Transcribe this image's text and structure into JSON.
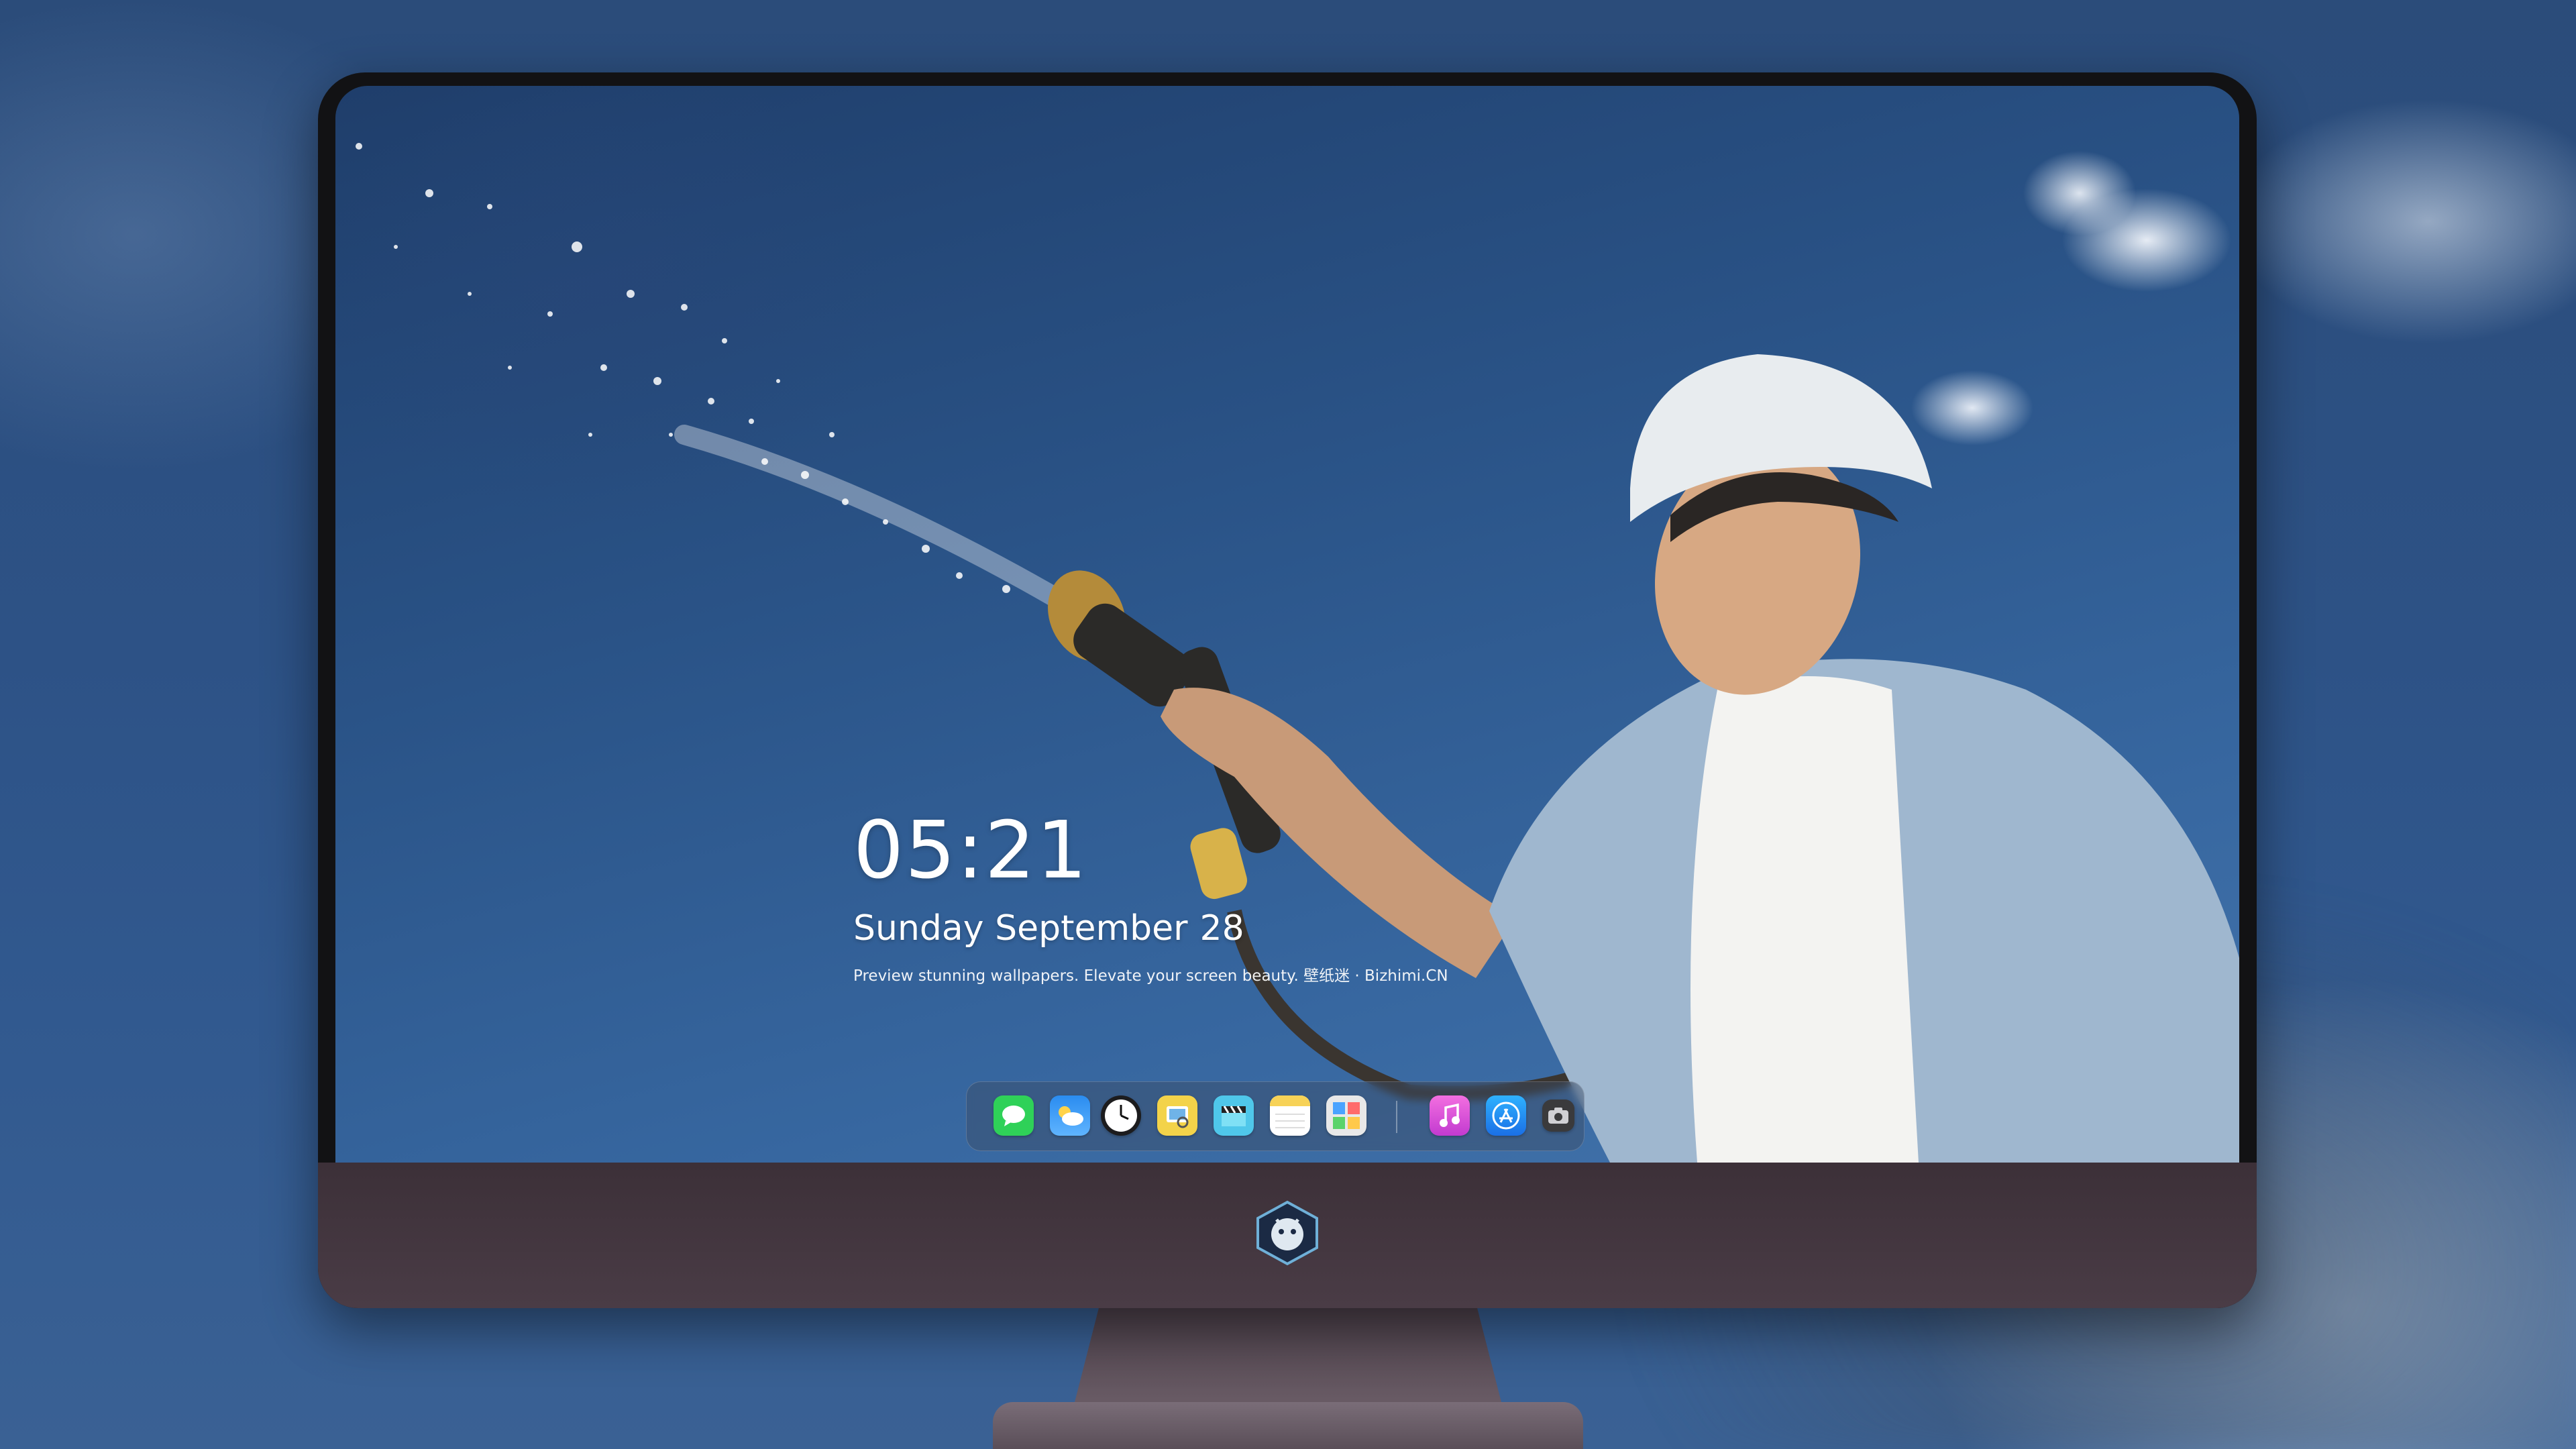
{
  "lockscreen": {
    "time": "05:21",
    "weekday_month": "Sunday September",
    "day": "28",
    "tagline": "Preview stunning wallpapers. Elevate your screen beauty. 壁纸迷 · Bizhimi.CN"
  },
  "dock": {
    "apps": [
      {
        "name": "messages-icon",
        "color": "#2fd158"
      },
      {
        "name": "weather-icon",
        "color": "#2a8cf0"
      },
      {
        "name": "clock-icon",
        "color": "#1c1c1e"
      },
      {
        "name": "preview-icon",
        "color": "#f3d34a"
      },
      {
        "name": "clips-icon",
        "color": "#4fc7ea"
      },
      {
        "name": "notes-icon",
        "color": "#f7d257"
      },
      {
        "name": "photo-booth-icon",
        "color": "#e8e8e8"
      },
      {
        "name": "music-icon",
        "color": "#e84fd6"
      },
      {
        "name": "app-store-icon",
        "color": "#1e90ff"
      },
      {
        "name": "camera-icon",
        "color": "#3a3a3c"
      }
    ]
  },
  "colors": {
    "sky": "#2a5387",
    "bezel": "#121214",
    "chin": "#45374a"
  }
}
